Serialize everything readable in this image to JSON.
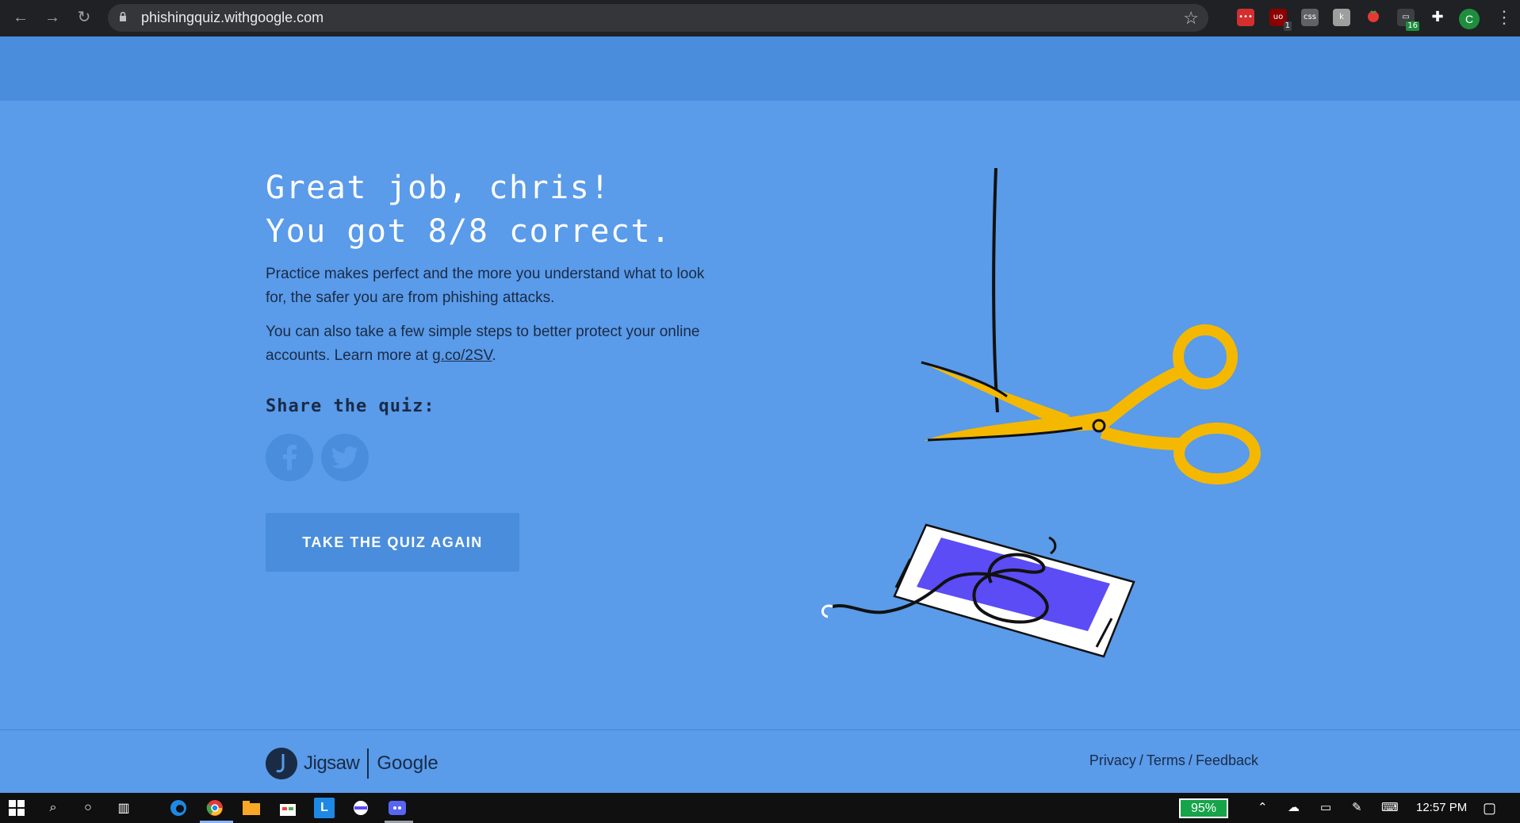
{
  "browser": {
    "url": "phishingquiz.withgoogle.com",
    "profile_initial": "C",
    "extensions": [
      {
        "name": "lastpass-icon",
        "color": "#d32f2f",
        "badge": ""
      },
      {
        "name": "ublock-icon",
        "color": "#8b0000",
        "badge": "1"
      },
      {
        "name": "css-icon",
        "color": "#5f6368",
        "badge": ""
      },
      {
        "name": "k-icon",
        "color": "#9e9e9e",
        "badge": ""
      },
      {
        "name": "tomato-icon",
        "color": "#e53935",
        "badge": ""
      },
      {
        "name": "tab-counter-icon",
        "color": "#3c4043",
        "badge": "16"
      }
    ]
  },
  "result": {
    "headline_line1": "Great job, chris!",
    "headline_line2": "You got 8/8 correct.",
    "para1": "Practice makes perfect and the more you understand what to look for, the safer you are from phishing attacks.",
    "para2_before": "You can also take a few simple steps to better protect your online accounts. Learn more at ",
    "para2_link": "g.co/2SV",
    "para2_after": ".",
    "share_title": "Share the quiz:",
    "retake_label": "TAKE THE QUIZ AGAIN"
  },
  "footer": {
    "brand_jigsaw": "Jigsaw",
    "brand_google": "Google",
    "links": [
      "Privacy",
      "Terms",
      "Feedback"
    ],
    "separator": "/"
  },
  "taskbar": {
    "battery": "95%",
    "time": "12:57 PM"
  },
  "colors": {
    "page_bg": "#5a9bea",
    "band_bg": "#4a8ddc",
    "scissors": "#f5b800",
    "phone_screen": "#5b4cf5"
  }
}
